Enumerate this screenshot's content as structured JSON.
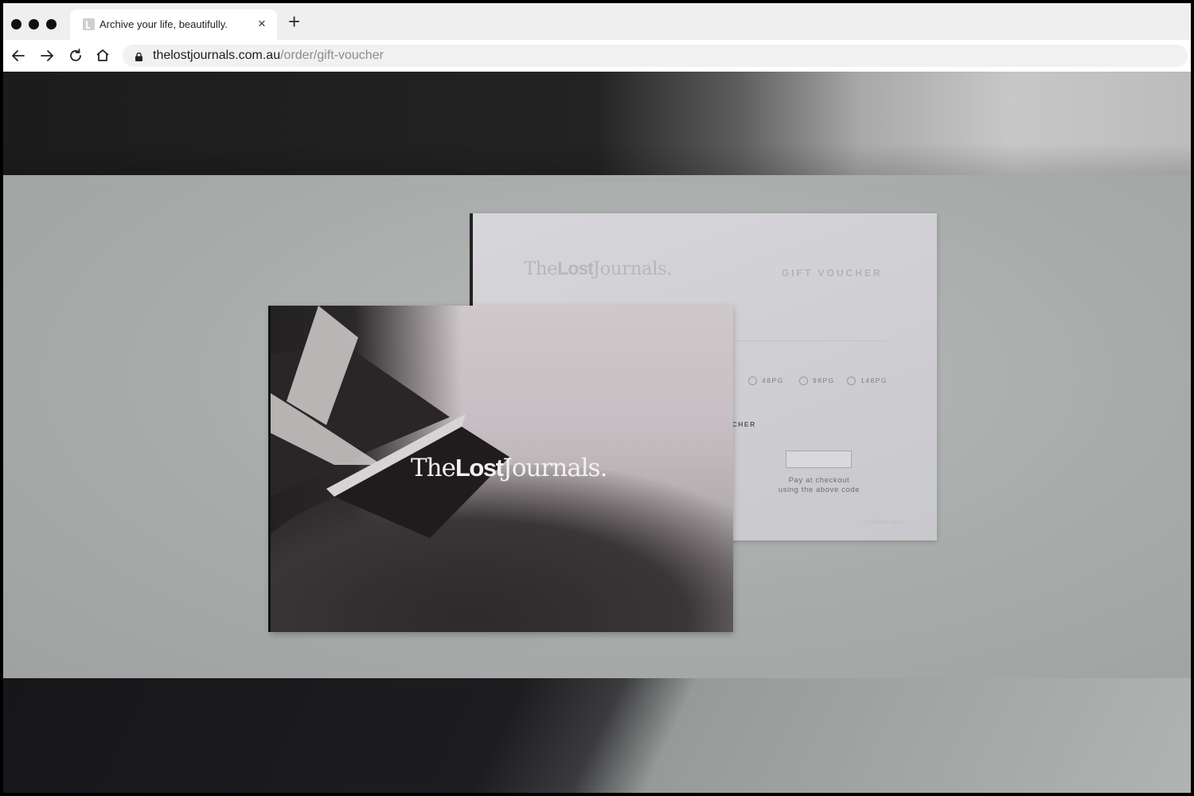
{
  "window": {
    "controls": [
      "close-dot",
      "minimize-dot",
      "zoom-dot"
    ]
  },
  "tab": {
    "title": "Archive your life, beautifully.",
    "close_label": "×",
    "favicon": "L",
    "new_tab_label": "+"
  },
  "toolbar": {
    "back_icon": "arrow-left-icon",
    "forward_icon": "arrow-right-icon",
    "reload_icon": "reload-icon",
    "home_icon": "home-icon"
  },
  "address": {
    "host": "thelostjournals.com.au",
    "path": "/order/gift-voucher",
    "secure_icon": "lock-icon"
  },
  "voucher": {
    "logo_the": "The",
    "logo_lost": "Lost",
    "logo_journals": "Journals.",
    "title": "GIFT VOUCHER",
    "options": [
      "48PG",
      "98PG",
      "148PG"
    ],
    "label": "UCHER",
    "pay_line1": "Pay at checkout",
    "pay_line2": "using the above code",
    "fine_print": "Conditions apply"
  },
  "cover": {
    "logo_the": "The",
    "logo_lost": "Lost",
    "logo_journals": "Journals."
  },
  "colors": {
    "tabbar": "#efefef",
    "urlbar": "#f1f1f1",
    "url_path": "#8c8c8c",
    "backdrop": "#a6aaa8"
  }
}
